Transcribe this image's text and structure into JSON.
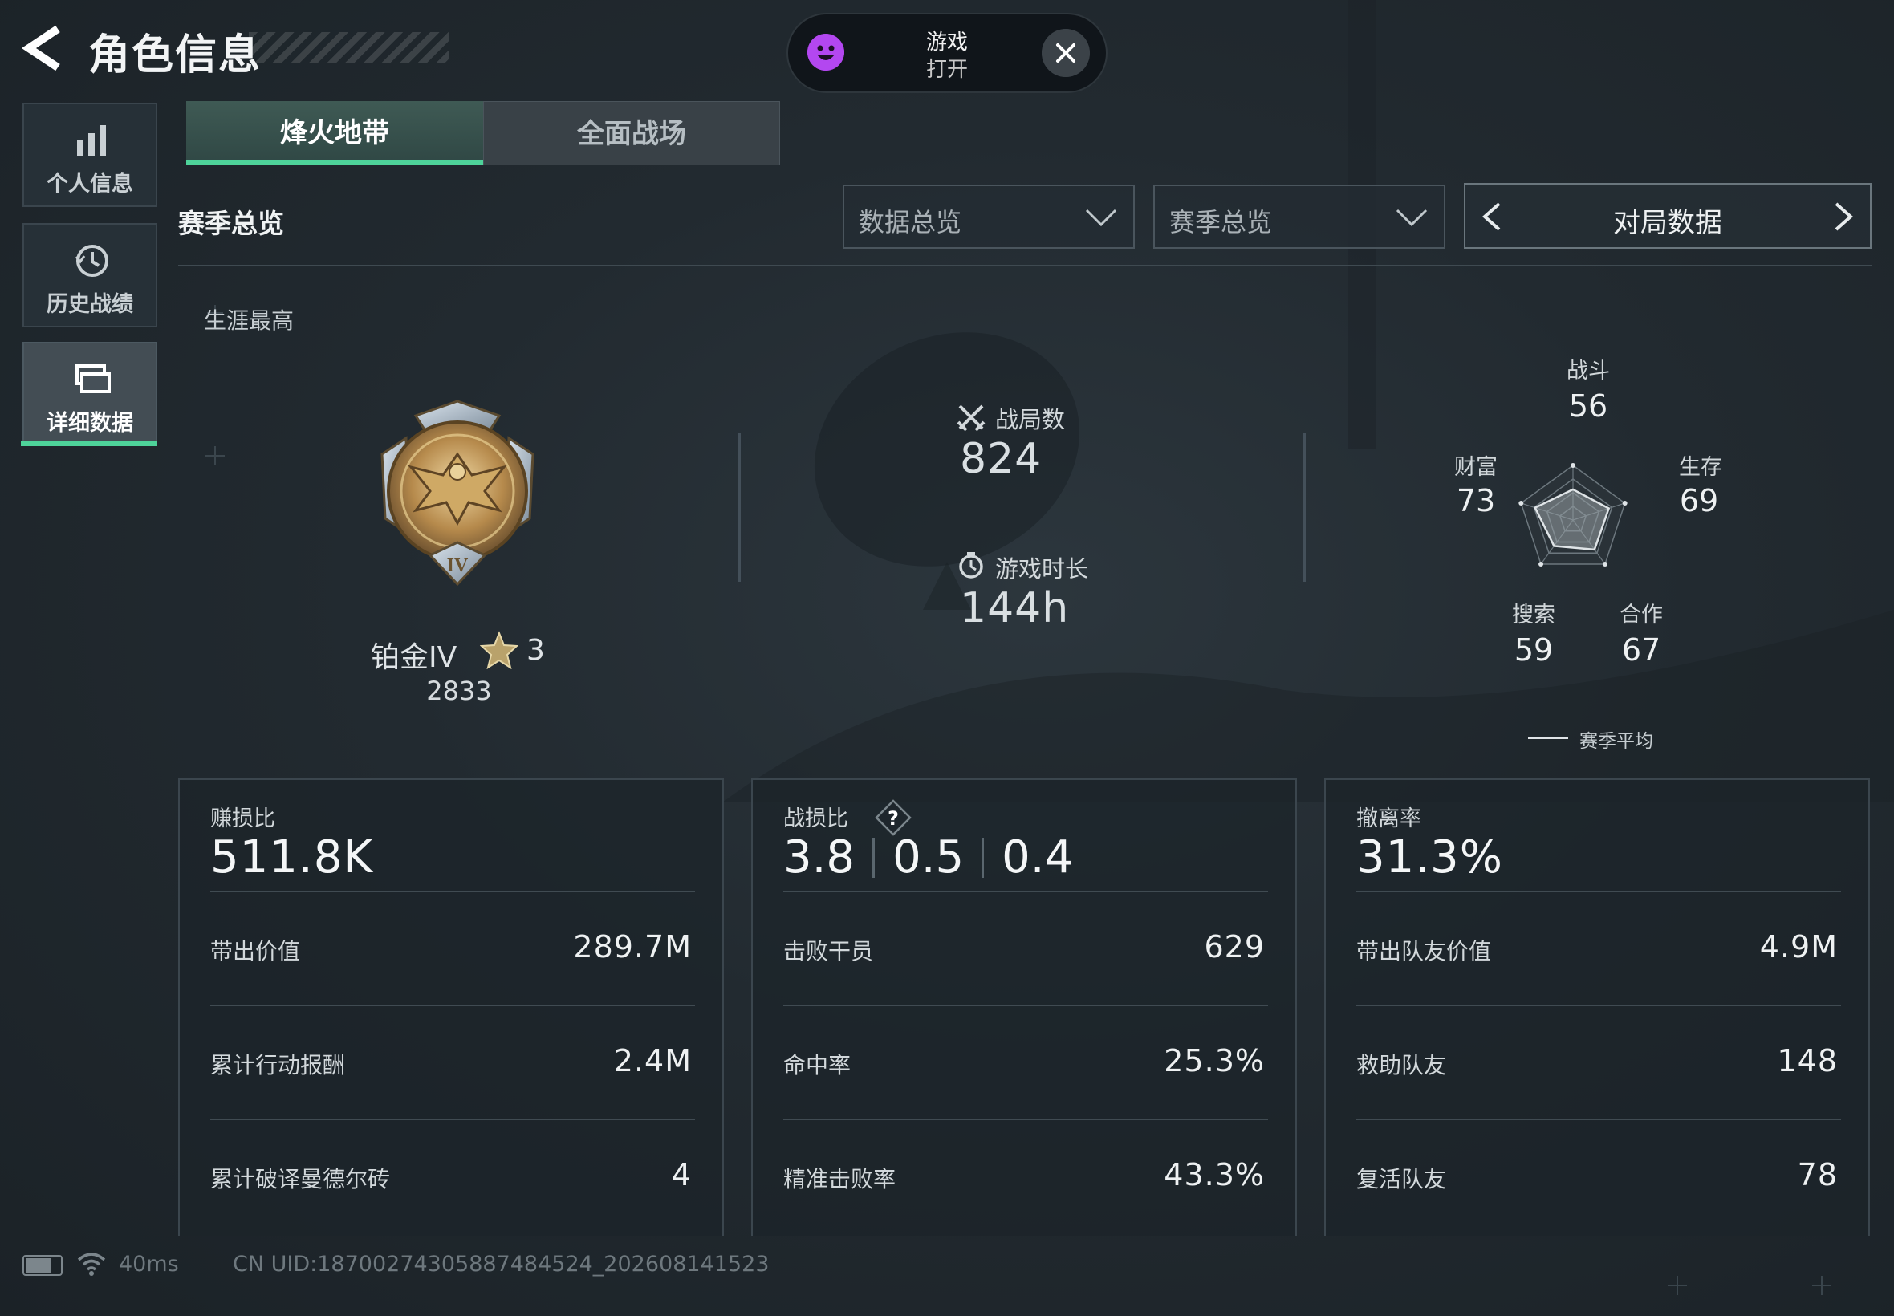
{
  "header": {
    "title": "角色信息",
    "back_icon": "back-arrow-icon"
  },
  "overlay_pill": {
    "title": "游戏",
    "subtitle": "打开",
    "icon": "smiley-icon",
    "close_icon": "close-icon"
  },
  "sidebar": {
    "items": [
      {
        "label": "个人信息",
        "icon": "bar-chart-icon",
        "active": false
      },
      {
        "label": "历史战绩",
        "icon": "history-clock-icon",
        "active": false
      },
      {
        "label": "详细数据",
        "icon": "data-cards-icon",
        "active": true
      }
    ]
  },
  "tabs": [
    {
      "label": "烽火地带",
      "active": true
    },
    {
      "label": "全面战场",
      "active": false
    }
  ],
  "filters": {
    "section_label": "赛季总览",
    "dropdown1": "数据总览",
    "dropdown2": "赛季总览",
    "nav_label": "对局数据"
  },
  "career": {
    "label": "生涯最高",
    "rank_name": "铂金IV",
    "rank_stars": "3",
    "rank_points": "2833",
    "medal_numeral": "IV"
  },
  "summary": {
    "matches_label": "战局数",
    "matches_value": "824",
    "playtime_label": "游戏时长",
    "playtime_value": "144h"
  },
  "radar": {
    "axes": [
      {
        "label": "战斗",
        "value": 56
      },
      {
        "label": "生存",
        "value": 69
      },
      {
        "label": "合作",
        "value": 67
      },
      {
        "label": "搜索",
        "value": 59
      },
      {
        "label": "财富",
        "value": 73
      }
    ],
    "legend": "赛季平均"
  },
  "cards": {
    "profit": {
      "head_label": "赚损比",
      "head_value": "511.8K",
      "rows": [
        {
          "label": "带出价值",
          "value": "289.7M"
        },
        {
          "label": "累计行动报酬",
          "value": "2.4M"
        },
        {
          "label": "累计破译曼德尔砖",
          "value": "4"
        }
      ]
    },
    "combat": {
      "head_label": "战损比",
      "head_values": [
        "3.8",
        "0.5",
        "0.4"
      ],
      "rows": [
        {
          "label": "击败干员",
          "value": "629"
        },
        {
          "label": "命中率",
          "value": "25.3%"
        },
        {
          "label": "精准击败率",
          "value": "43.3%"
        }
      ]
    },
    "extract": {
      "head_label": "撤离率",
      "head_value": "31.3%",
      "rows": [
        {
          "label": "带出队友价值",
          "value": "4.9M"
        },
        {
          "label": "救助队友",
          "value": "148"
        },
        {
          "label": "复活队友",
          "value": "78"
        }
      ]
    }
  },
  "status_bar": {
    "ping": "40ms",
    "uid": "CN UID:18700274305887484524_202608141523"
  },
  "colors": {
    "accent": "#4ed39a",
    "background": "#222a30",
    "pill_icon": "#b347f0"
  }
}
